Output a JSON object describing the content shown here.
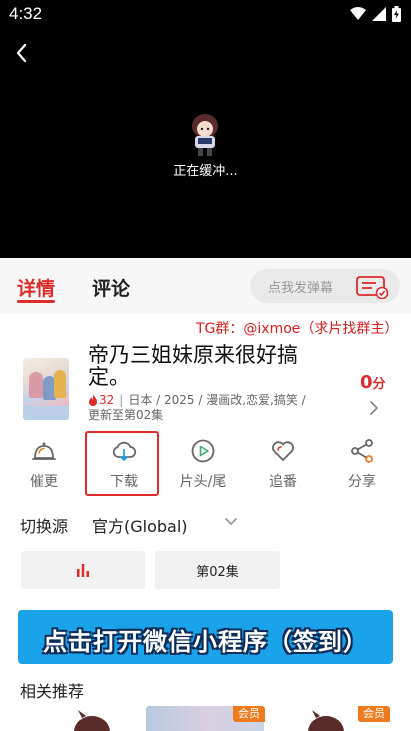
{
  "status_bar": {
    "time": "4:32"
  },
  "player": {
    "buffering_text": "正在缓冲..."
  },
  "tabs": [
    {
      "label": "详情",
      "active": true
    },
    {
      "label": "评论",
      "active": false
    }
  ],
  "danmu": {
    "placeholder": "点我发弹幕"
  },
  "notice": "TG群：@ixmoe（求片找群主）",
  "anime": {
    "title": "帝乃三姐妹原来很好搞定。",
    "hot_count": "32",
    "meta": "日本 / 2025 / 漫画改,恋爱,搞笑 /",
    "update_status": "更新至第02集",
    "score_value": "0",
    "score_unit": "分"
  },
  "actions": [
    {
      "label": "催更",
      "icon": "bell-icon"
    },
    {
      "label": "下载",
      "icon": "cloud-download-icon"
    },
    {
      "label": "片头/尾",
      "icon": "play-circle-icon"
    },
    {
      "label": "追番",
      "icon": "heart-icon"
    },
    {
      "label": "分享",
      "icon": "share-icon"
    }
  ],
  "source": {
    "label": "切换源",
    "value": "官方(Global)"
  },
  "episodes": {
    "current": "第02集"
  },
  "banner": {
    "text": "点击打开微信小程序（签到）"
  },
  "recommend": {
    "title": "相关推荐",
    "vip_badges": [
      "会员",
      "会员"
    ]
  },
  "colors": {
    "accent": "#e02b2b",
    "banner_bg": "#1aa3e8",
    "vip_badge": "#f07b1e"
  }
}
